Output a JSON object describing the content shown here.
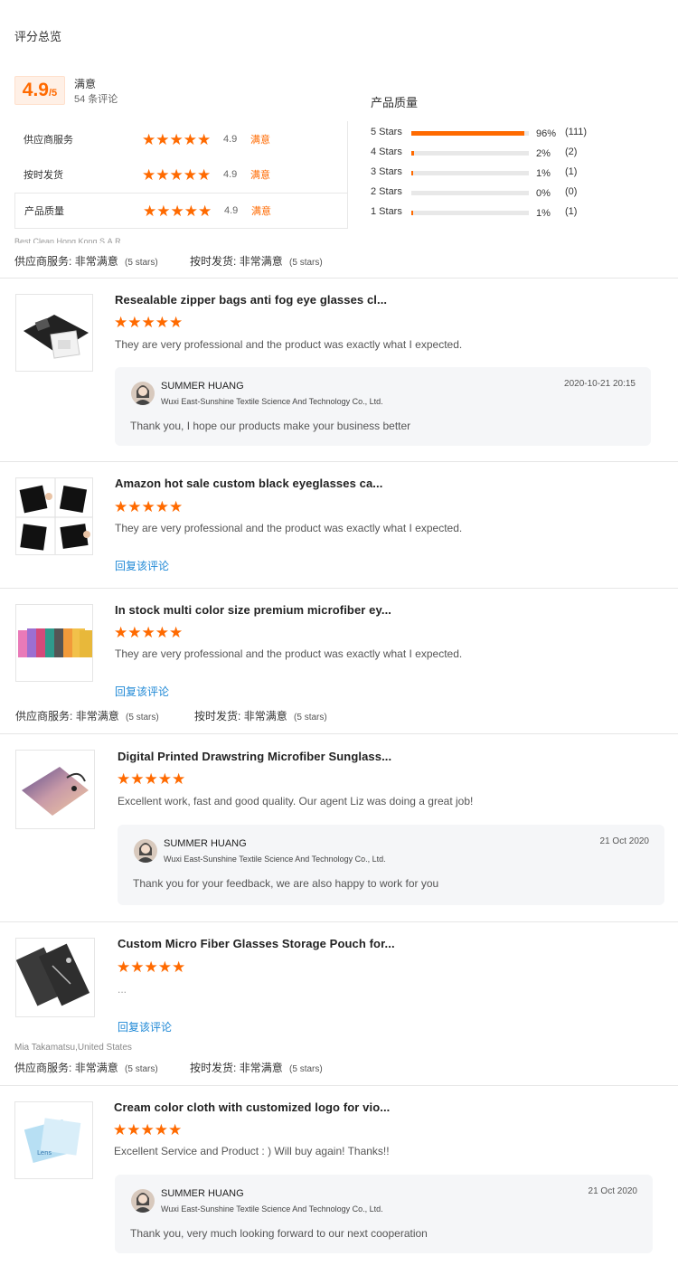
{
  "summary": {
    "title": "评分总览",
    "score": "4.9",
    "score_max": "/5",
    "satisfaction": "满意",
    "review_count": "54 条评论",
    "metrics": [
      {
        "label": "供应商服务",
        "value": "4.9",
        "sat": "满意"
      },
      {
        "label": "按时发货",
        "value": "4.9",
        "sat": "满意"
      },
      {
        "label": "产品质量",
        "value": "4.9",
        "sat": "满意"
      }
    ]
  },
  "distribution": {
    "title": "产品质量",
    "rows": [
      {
        "label": "5 Stars",
        "percent": 96,
        "pct_text": "96%",
        "count": "(111)"
      },
      {
        "label": "4 Stars",
        "percent": 2,
        "pct_text": "2%",
        "count": "(2)"
      },
      {
        "label": "3 Stars",
        "percent": 1,
        "pct_text": "1%",
        "count": "(1)"
      },
      {
        "label": "2 Stars",
        "percent": 0,
        "pct_text": "0%",
        "count": "(0)"
      },
      {
        "label": "1 Stars",
        "percent": 1,
        "pct_text": "1%",
        "count": "(1)"
      }
    ]
  },
  "rating_labels": {
    "service": "供应商服务:",
    "delivery": "按时发货:",
    "very_satisfied": "非常满意",
    "five_stars": "(5 stars)"
  },
  "top_reviewer": "Best Clean,Hong Kong S.A.R.",
  "reviews": [
    {
      "title": "Resealable zipper bags anti fog eye glasses cl...",
      "text": "They are very professional and the product was exactly what I expected.",
      "reply": {
        "name": "SUMMER HUANG",
        "company": "Wuxi East-Sunshine Textile Science And Technology Co., Ltd.",
        "date": "2020-10-21 20:15",
        "text": "Thank you, I hope our products make your business better"
      }
    },
    {
      "title": "Amazon hot sale custom black eyeglasses ca...",
      "text": "They are very professional and the product was exactly what I expected.",
      "link": "回复该评论"
    },
    {
      "title": "In stock multi color size premium microfiber ey...",
      "text": "They are very professional and the product was exactly what I expected.",
      "link": "回复该评论"
    },
    {
      "title": "Digital Printed Drawstring Microfiber Sunglass...",
      "text": "Excellent work, fast and good quality. Our agent Liz was doing a great job!",
      "reply": {
        "name": "SUMMER HUANG",
        "company": "Wuxi East-Sunshine Textile Science And Technology Co., Ltd.",
        "date": "21 Oct 2020",
        "text": "Thank you for your feedback, we are also happy to work for you"
      }
    },
    {
      "title": "Custom Micro Fiber Glasses Storage Pouch for...",
      "text": "...",
      "link": "回复该评论",
      "reviewer": "Mia Takamatsu,United States"
    },
    {
      "title": "Cream color cloth with customized logo for vio...",
      "text": "Excellent Service and Product : ) Will buy again! Thanks!!",
      "reply": {
        "name": "SUMMER HUANG",
        "company": "Wuxi East-Sunshine Textile Science And Technology Co., Ltd.",
        "date": "21 Oct 2020",
        "text": "Thank you, very much looking forward to our next cooperation"
      }
    }
  ],
  "colors": {
    "accent": "#ff6a00",
    "link": "#1e88d6"
  }
}
